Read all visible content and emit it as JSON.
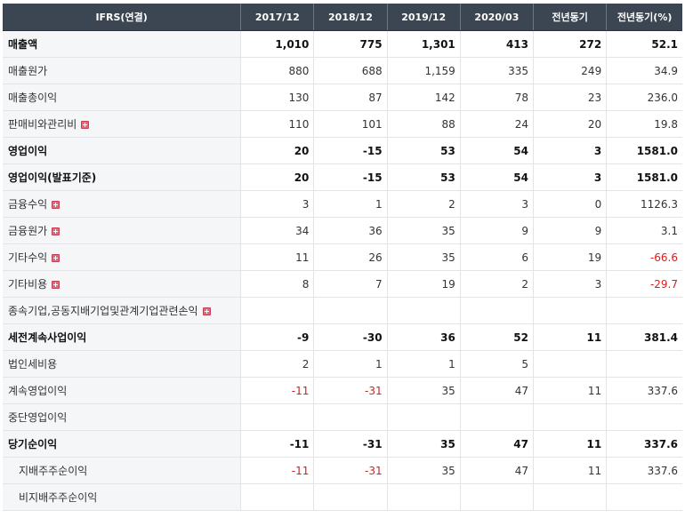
{
  "table": {
    "headers": [
      "IFRS(연결)",
      "2017/12",
      "2018/12",
      "2019/12",
      "2020/03",
      "전년동기",
      "전년동기(%)"
    ],
    "rows": [
      {
        "label": "매출액",
        "bold": true,
        "expand": false,
        "values": [
          "1,010",
          "775",
          "1,301",
          "413",
          "272",
          "52.1"
        ]
      },
      {
        "label": "매출원가",
        "values": [
          "880",
          "688",
          "1,159",
          "335",
          "249",
          "34.9"
        ]
      },
      {
        "label": "매출총이익",
        "values": [
          "130",
          "87",
          "142",
          "78",
          "23",
          "236.0"
        ]
      },
      {
        "label": "판매비와관리비",
        "expand": true,
        "values": [
          "110",
          "101",
          "88",
          "24",
          "20",
          "19.8"
        ]
      },
      {
        "label": "영업이익",
        "bold": true,
        "sep": true,
        "values": [
          "20",
          "-15",
          "53",
          "54",
          "3",
          "1581.0"
        ]
      },
      {
        "label": "영업이익(발표기준)",
        "bold": true,
        "values": [
          "20",
          "-15",
          "53",
          "54",
          "3",
          "1581.0"
        ]
      },
      {
        "label": "금융수익",
        "expand": true,
        "values": [
          "3",
          "1",
          "2",
          "3",
          "0",
          "1126.3"
        ]
      },
      {
        "label": "금융원가",
        "expand": true,
        "values": [
          "34",
          "36",
          "35",
          "9",
          "9",
          "3.1"
        ]
      },
      {
        "label": "기타수익",
        "expand": true,
        "values": [
          "11",
          "26",
          "35",
          "6",
          "19",
          "-66.6"
        ]
      },
      {
        "label": "기타비용",
        "expand": true,
        "values": [
          "8",
          "7",
          "19",
          "2",
          "3",
          "-29.7"
        ]
      },
      {
        "label": "종속기업,공동지배기업및관계기업관련손익",
        "expand": true,
        "values": [
          "",
          "",
          "",
          "",
          "",
          ""
        ]
      },
      {
        "label": "세전계속사업이익",
        "bold": true,
        "sep": true,
        "values": [
          "-9",
          "-30",
          "36",
          "52",
          "11",
          "381.4"
        ]
      },
      {
        "label": "법인세비용",
        "values": [
          "2",
          "1",
          "1",
          "5",
          "",
          ""
        ]
      },
      {
        "label": "계속영업이익",
        "values": [
          "-11",
          "-31",
          "35",
          "47",
          "11",
          "337.6"
        ]
      },
      {
        "label": "중단영업이익",
        "values": [
          "",
          "",
          "",
          "",
          "",
          ""
        ]
      },
      {
        "label": "당기순이익",
        "bold": true,
        "sep": true,
        "values": [
          "-11",
          "-31",
          "35",
          "47",
          "11",
          "337.6"
        ]
      },
      {
        "label": "지배주주순이익",
        "indent": true,
        "values": [
          "-11",
          "-31",
          "35",
          "47",
          "11",
          "337.6"
        ]
      },
      {
        "label": "비지배주주순이익",
        "indent": true,
        "values": [
          "",
          "",
          "",
          "",
          "",
          ""
        ]
      }
    ]
  },
  "colors": {
    "header_bg": "#3c4552",
    "negative": "#d42020",
    "expand_icon": "#e8667a"
  },
  "icons": {
    "expand": "plus-icon"
  }
}
